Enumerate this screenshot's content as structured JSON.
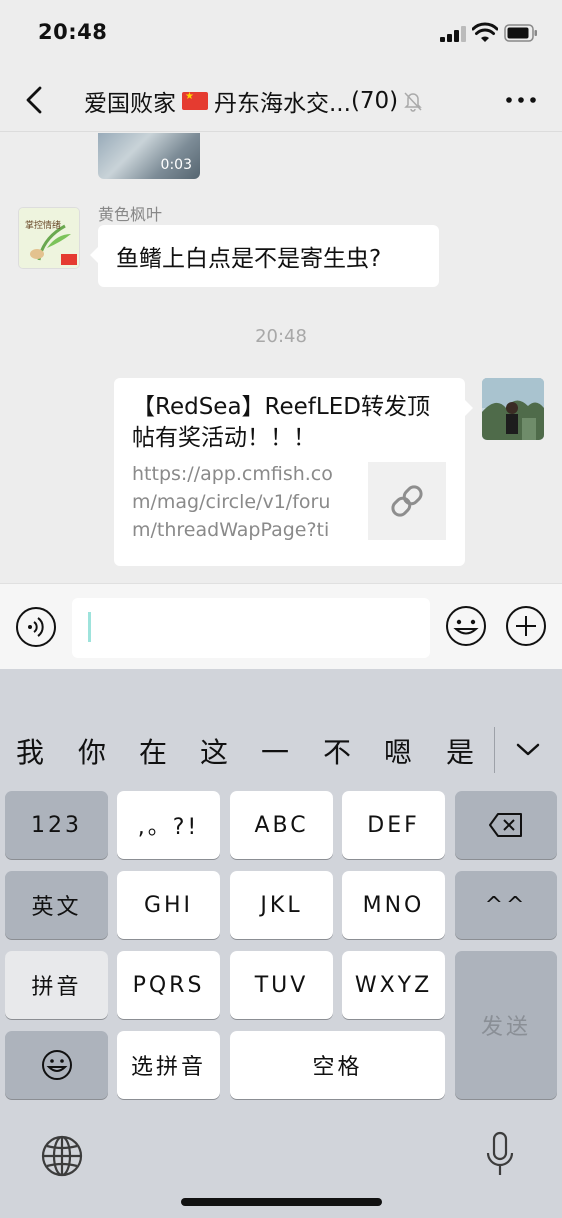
{
  "status": {
    "time": "20:48"
  },
  "header": {
    "title_part1": "爱国败家",
    "title_part2": "丹东海水交...",
    "member_count": "(70)"
  },
  "messages": {
    "video_duration": "0:03",
    "sender_name": "黄色枫叶",
    "text_message": "鱼鳍上白点是不是寄生虫?",
    "time_divider": "20:48",
    "link_card": {
      "title": "【RedSea】ReefLED转发顶帖有奖活动！！！",
      "url": "https://app.cmfish.com/mag/circle/v1/forum/threadWapPage?tid..."
    }
  },
  "input": {
    "value": ""
  },
  "keyboard": {
    "candidates": [
      "我",
      "你",
      "在",
      "这",
      "一",
      "不",
      "嗯",
      "是"
    ],
    "keys": {
      "num": "123",
      "punct": ",。?!",
      "abc": "ABC",
      "def": "DEF",
      "english": "英文",
      "ghi": "GHI",
      "jkl": "JKL",
      "mno": "MNO",
      "emoticon": "^^",
      "pinyin": "拼音",
      "pqrs": "PQRS",
      "tuv": "TUV",
      "wxyz": "WXYZ",
      "send": "发送",
      "select_pinyin": "选拼音",
      "space": "空格"
    }
  },
  "icons": [
    "back-icon",
    "mute-icon",
    "more-icon",
    "voice-icon",
    "emoji-icon",
    "plus-icon",
    "link-icon",
    "backspace-icon",
    "smiley-icon",
    "globe-icon",
    "mic-icon",
    "collapse-chevron-icon"
  ]
}
